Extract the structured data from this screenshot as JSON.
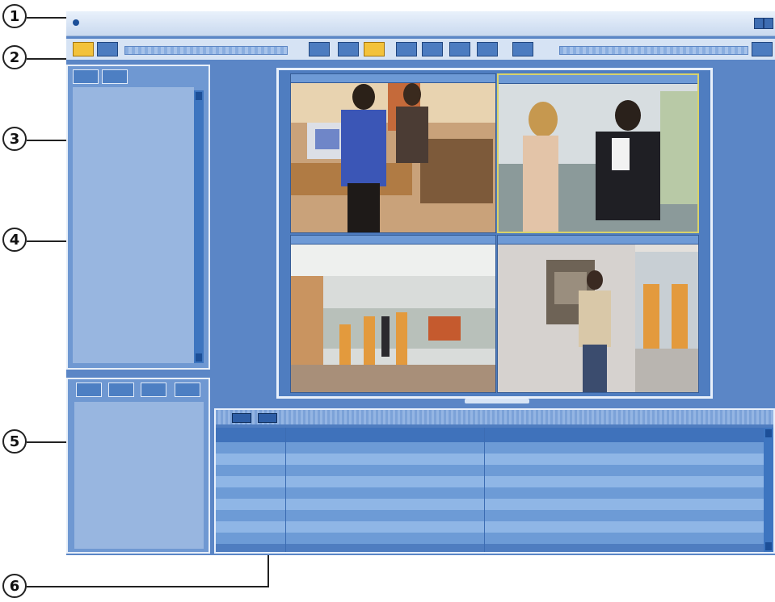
{
  "callouts": [
    "1",
    "2",
    "3",
    "4",
    "5",
    "6"
  ],
  "icons": {
    "title_icon": "app-icon",
    "toolbar": [
      "camera-icon",
      "record-icon",
      "snapshot-icon",
      "single-view-icon",
      "quad-view-icon",
      "grid9-icon",
      "grid16-icon",
      "grid25-icon",
      "sequence-icon",
      "export-icon",
      "close-icon"
    ],
    "left_tabs_top": [
      "cameras-tab-icon",
      "groups-tab-icon"
    ],
    "left_tabs_bottom": [
      "users-tab-icon",
      "edit-tab-icon",
      "alarms-tab-icon",
      "settings-tab-icon"
    ],
    "timeline": [
      "play-icon",
      "stop-icon"
    ]
  },
  "colors": {
    "window_bg": "#5b86c6",
    "panel_bg": "#98b6e0",
    "accent_active": "#f3c23b"
  }
}
